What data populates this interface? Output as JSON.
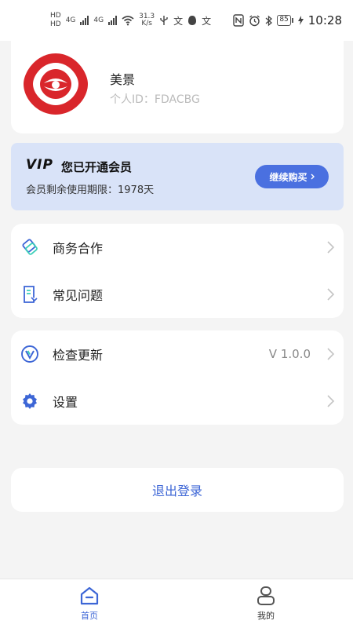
{
  "status_bar": {
    "hd_top": "HD",
    "hd_bottom": "HD",
    "net_type": "4G",
    "net_type2": "4G",
    "speed_value": "31.3",
    "speed_unit": "K/s",
    "time": "10:28",
    "battery_level": "85"
  },
  "profile": {
    "username": "美景",
    "user_id_label": "个人ID：",
    "user_id": "FDACBG"
  },
  "vip": {
    "logo": "VIP",
    "title": "您已开通会员",
    "remaining_label": "会员剩余使用期限：",
    "remaining_value": "1978天",
    "renew_label": "继续购买"
  },
  "menu_group1": [
    {
      "label": "商务合作",
      "icon": "handshake-icon"
    },
    {
      "label": "常见问题",
      "icon": "faq-document-icon"
    }
  ],
  "menu_group2": [
    {
      "label": "检查更新",
      "icon": "version-v-icon",
      "value": "V 1.0.0"
    },
    {
      "label": "设置",
      "icon": "gear-icon"
    }
  ],
  "logout_label": "退出登录",
  "bottom_nav": [
    {
      "label": "首页",
      "icon": "home-icon",
      "active": true
    },
    {
      "label": "我的",
      "icon": "profile-icon",
      "active": false
    }
  ],
  "colors": {
    "accent": "#3d66d6",
    "vip_bg": "#d9e3f8",
    "renew_button": "#4a70e0",
    "logo_red": "#d9262b"
  }
}
